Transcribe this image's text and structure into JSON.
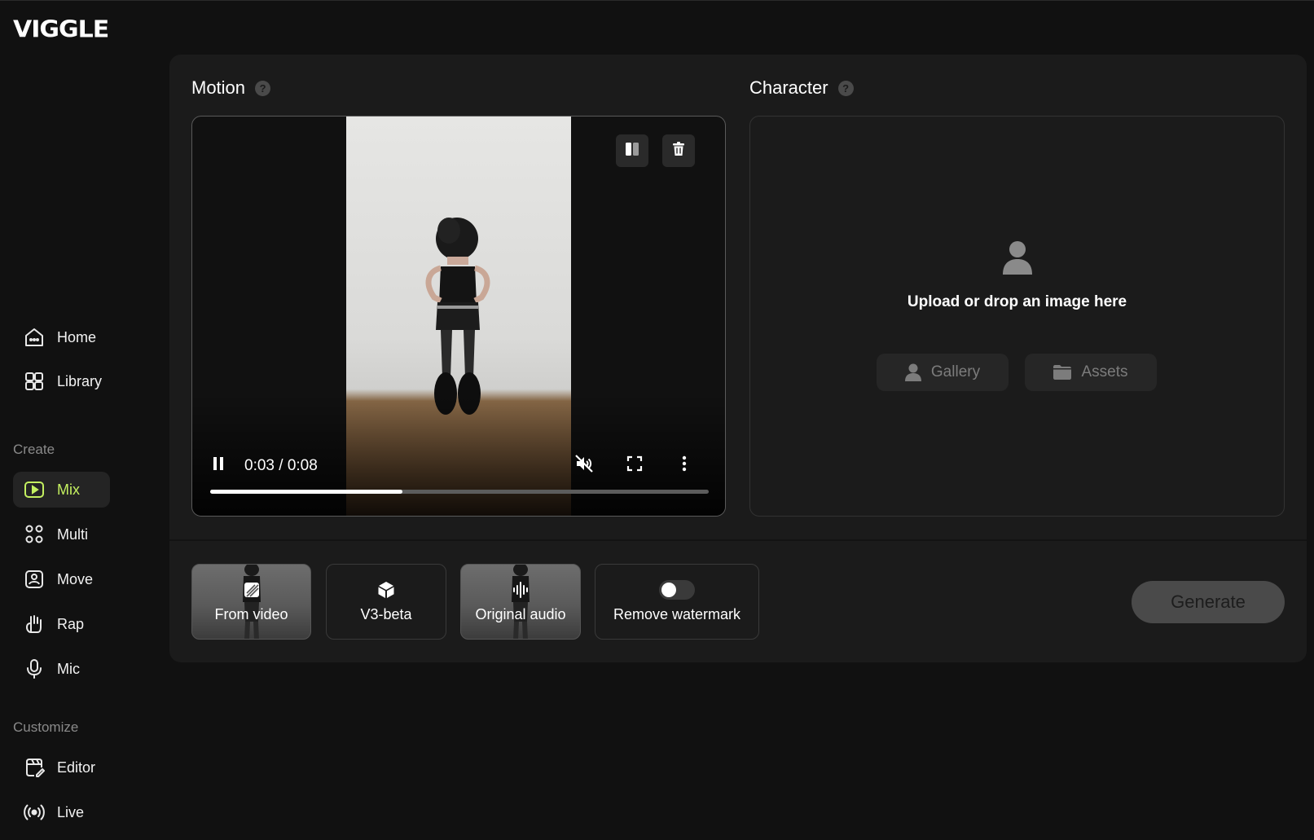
{
  "brand": {
    "logo_text": "VIGGLE"
  },
  "sidebar": {
    "main_items": [
      {
        "label": "Home",
        "icon": "home-icon"
      },
      {
        "label": "Library",
        "icon": "library-icon"
      }
    ],
    "create_label": "Create",
    "create_items": [
      {
        "label": "Mix",
        "icon": "mix-icon",
        "active": true
      },
      {
        "label": "Multi",
        "icon": "multi-icon"
      },
      {
        "label": "Move",
        "icon": "move-icon"
      },
      {
        "label": "Rap",
        "icon": "rap-icon"
      },
      {
        "label": "Mic",
        "icon": "mic-icon"
      }
    ],
    "customize_label": "Customize",
    "customize_items": [
      {
        "label": "Editor",
        "icon": "editor-icon"
      },
      {
        "label": "Live",
        "icon": "live-icon"
      }
    ]
  },
  "motion": {
    "title": "Motion",
    "video": {
      "current_time": "0:03",
      "duration": "0:08",
      "time_display": "0:03 / 0:08",
      "progress": 0.385,
      "muted": true,
      "playing": true
    }
  },
  "character": {
    "title": "Character",
    "upload_text": "Upload or drop an image here",
    "gallery_label": "Gallery",
    "assets_label": "Assets"
  },
  "options": {
    "from_video_label": "From video",
    "model_label": "V3-beta",
    "audio_label": "Original audio",
    "watermark_label": "Remove watermark",
    "watermark_enabled": false
  },
  "generate_label": "Generate",
  "colors": {
    "background": "#111111",
    "panel": "#1b1b1b",
    "accent": "#c4f060",
    "muted_text": "#8a8a8a"
  }
}
